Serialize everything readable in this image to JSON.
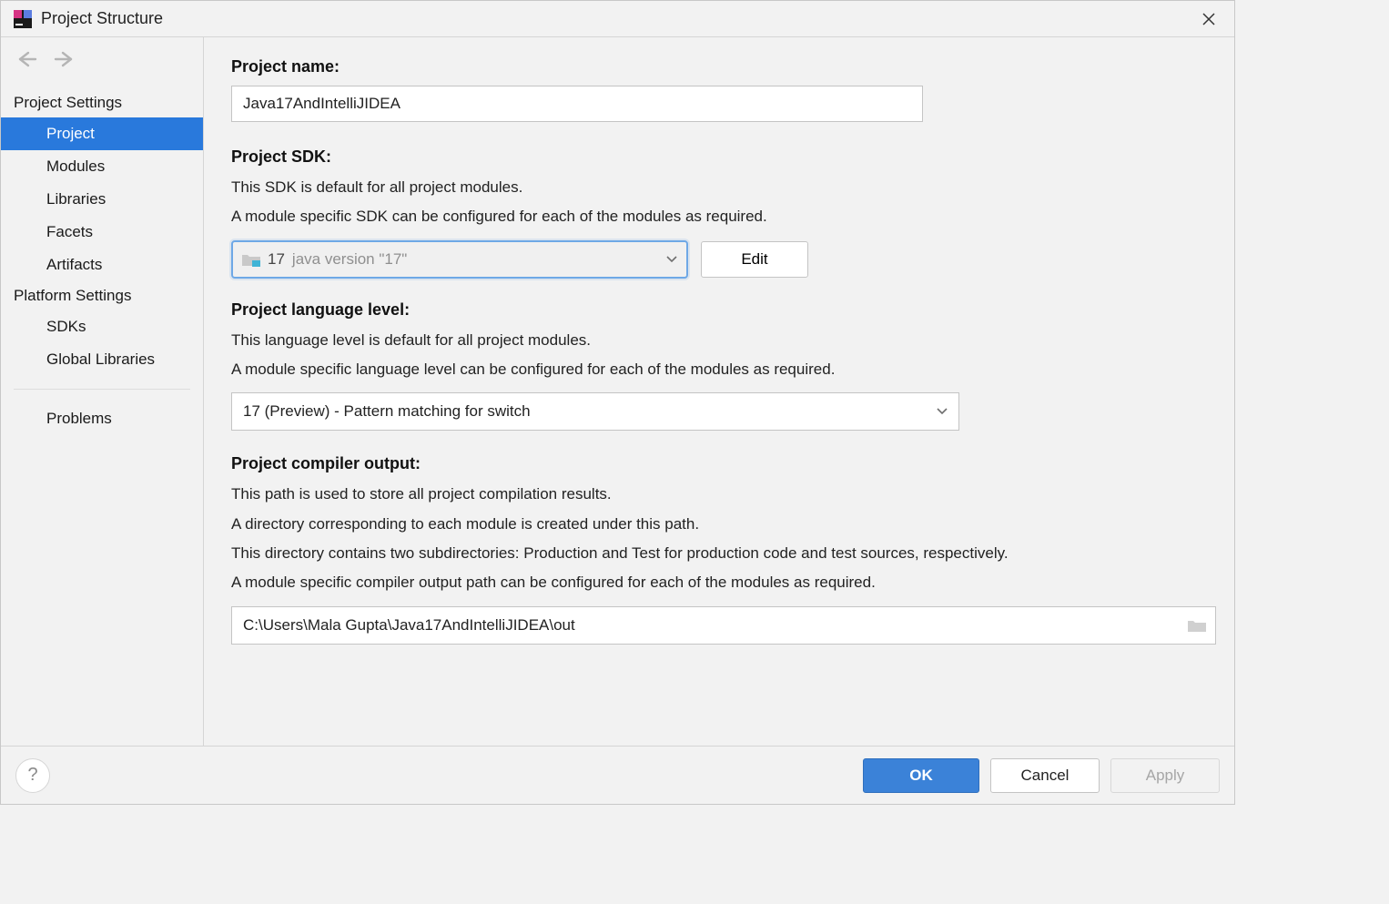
{
  "window_title": "Project Structure",
  "sections": {
    "project_settings_label": "Project Settings",
    "platform_settings_label": "Platform Settings"
  },
  "sidebar": {
    "items": [
      {
        "label": "Project",
        "selected": true
      },
      {
        "label": "Modules",
        "selected": false
      },
      {
        "label": "Libraries",
        "selected": false
      },
      {
        "label": "Facets",
        "selected": false
      },
      {
        "label": "Artifacts",
        "selected": false
      }
    ],
    "platform_items": [
      {
        "label": "SDKs"
      },
      {
        "label": "Global Libraries"
      }
    ],
    "problems_label": "Problems"
  },
  "main": {
    "project_name_label": "Project name:",
    "project_name_value": "Java17AndIntelliJIDEA",
    "sdk_label": "Project SDK:",
    "sdk_desc1": "This SDK is default for all project modules.",
    "sdk_desc2": "A module specific SDK can be configured for each of the modules as required.",
    "sdk_name": "17",
    "sdk_version": "java version \"17\"",
    "edit_label": "Edit",
    "lang_label": "Project language level:",
    "lang_desc1": "This language level is default for all project modules.",
    "lang_desc2": "A module specific language level can be configured for each of the modules as required.",
    "lang_value": "17 (Preview) - Pattern matching for switch",
    "output_label": "Project compiler output:",
    "output_desc1": "This path is used to store all project compilation results.",
    "output_desc2": "A directory corresponding to each module is created under this path.",
    "output_desc3": "This directory contains two subdirectories: Production and Test for production code and test sources, respectively.",
    "output_desc4": "A module specific compiler output path can be configured for each of the modules as required.",
    "output_value": "C:\\Users\\Mala Gupta\\Java17AndIntelliJIDEA\\out"
  },
  "footer": {
    "ok": "OK",
    "cancel": "Cancel",
    "apply": "Apply",
    "help": "?"
  }
}
